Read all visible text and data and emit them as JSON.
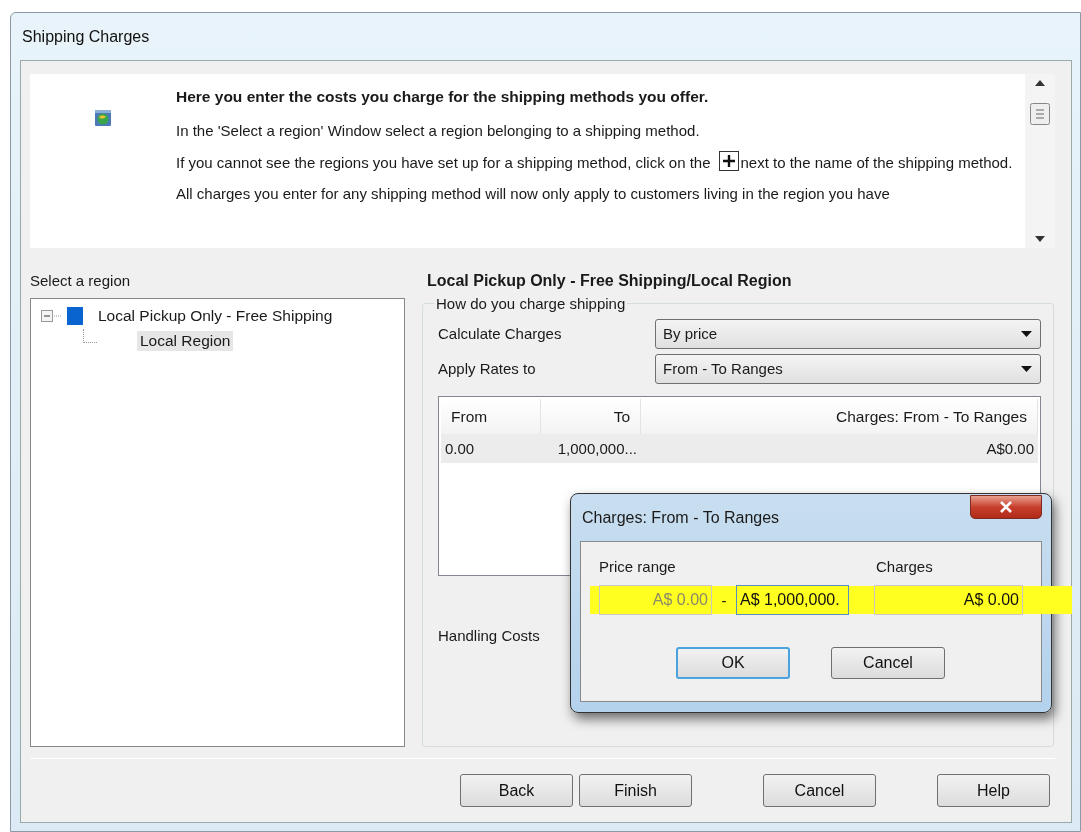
{
  "window": {
    "title": "Shipping Charges"
  },
  "info": {
    "heading": "Here you enter the costs you charge for the shipping methods you offer.",
    "paragraphs": [
      {
        "kind": "text",
        "text": "In the 'Select a region' Window select a region belonging to a shipping method."
      },
      {
        "kind": "with_icon",
        "before": "If you cannot see the regions you have set up for a shipping method, click on the",
        "after": "next to the name of the shipping method."
      },
      {
        "kind": "text",
        "text": "All charges you enter for any shipping method will now only apply to customers living in the region you have"
      }
    ]
  },
  "region_panel": {
    "label": "Select a region",
    "tree": [
      {
        "label": "Local Pickup Only - Free Shipping",
        "expanded": true,
        "selected": false,
        "children": [
          {
            "label": "Local Region",
            "selected": true
          }
        ]
      }
    ]
  },
  "details": {
    "heading": "Local Pickup Only - Free Shipping/Local Region",
    "group_label": "How do you charge shipping",
    "fields": [
      {
        "label": "Calculate Charges",
        "value": "By price"
      },
      {
        "label": "Apply Rates to",
        "value": "From - To Ranges"
      }
    ],
    "table": {
      "columns": [
        "From",
        "To",
        "Charges:  From - To Ranges"
      ],
      "rows": [
        {
          "cells": [
            "0.00",
            "1,000,000...",
            "A$0.00"
          ],
          "selected": true
        }
      ]
    },
    "handling_label": "Handling Costs"
  },
  "buttons": [
    {
      "label": "Back"
    },
    {
      "label": "Finish"
    },
    {
      "label": "Cancel"
    },
    {
      "label": "Help"
    }
  ],
  "dialog": {
    "title": "Charges:  From - To Ranges",
    "price_label": "Price range",
    "charges_label": "Charges",
    "separator": "-",
    "fields": [
      {
        "value": "A$ 0.00",
        "disabled": true,
        "focused": false
      },
      {
        "value": "A$ 1,000,000.",
        "disabled": false,
        "focused": true
      },
      {
        "value": "A$ 0.00",
        "disabled": false,
        "focused": false
      }
    ],
    "buttons": [
      {
        "label": "OK",
        "default": true
      },
      {
        "label": "Cancel",
        "default": false
      }
    ]
  }
}
